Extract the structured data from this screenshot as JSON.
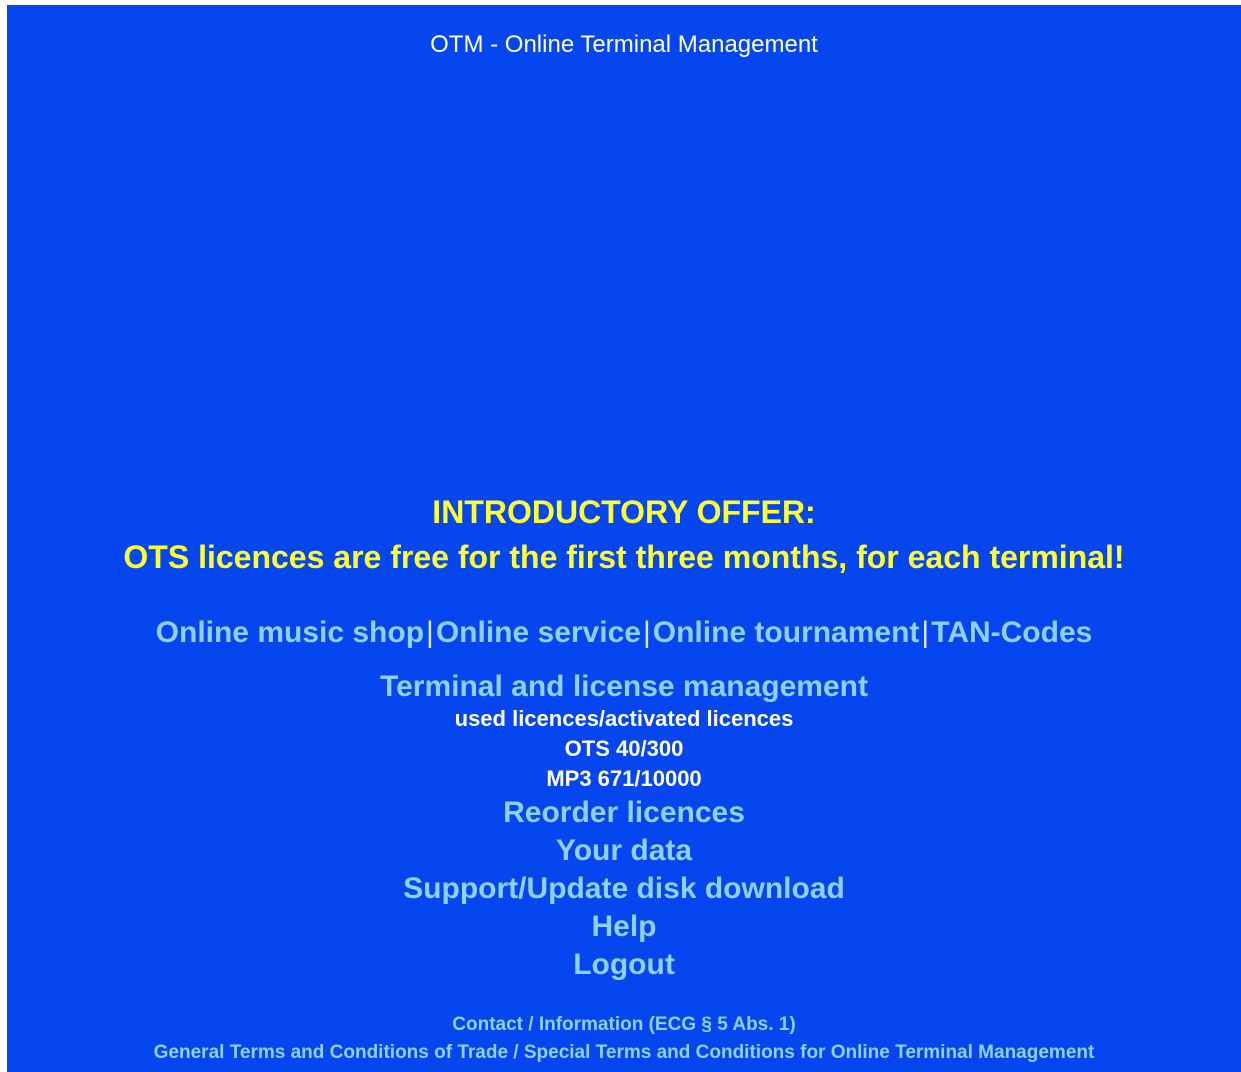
{
  "header": {
    "title": "OTM - Online Terminal Management"
  },
  "offer": {
    "heading": "INTRODUCTORY OFFER:",
    "text": "OTS licences are free for the first three months, for each terminal!"
  },
  "nav": {
    "music_shop": "Online music shop",
    "service": "Online service",
    "tournament": "Online tournament",
    "tan_codes": "TAN-Codes",
    "separator": "|"
  },
  "management": {
    "link": "Terminal and license management",
    "licence_header": "used licences/activated licences",
    "ots": "OTS 40/300",
    "mp3": "MP3 671/10000"
  },
  "links": {
    "reorder": "Reorder licences",
    "your_data": "Your data",
    "support": "Support/Update disk download",
    "help": "Help",
    "logout": "Logout"
  },
  "footer": {
    "contact": "Contact / Information (ECG § 5 Abs. 1)",
    "terms": "General Terms and Conditions of Trade / Special Terms and Conditions for Online Terminal Management"
  },
  "colors": {
    "background": "#0546ee",
    "offer": "#ffff33",
    "link": "#8fd0ff",
    "text": "#ffffff"
  }
}
